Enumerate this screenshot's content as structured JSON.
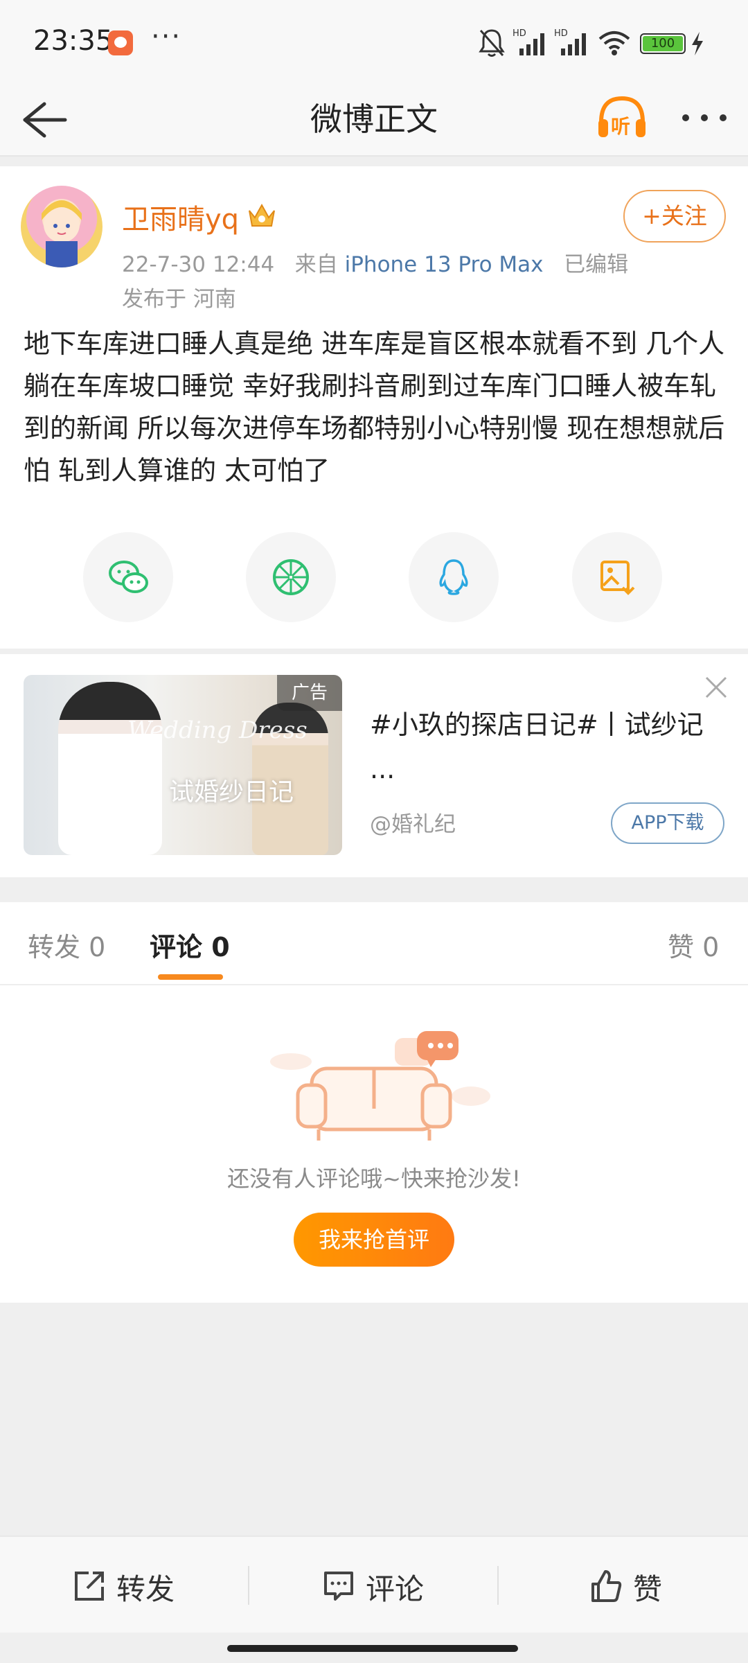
{
  "status_bar": {
    "time": "23:35",
    "more_dots": "···",
    "battery": "100",
    "icons": [
      "silent-bell-icon",
      "hd-signal-icon",
      "hd-signal-icon",
      "wifi-icon",
      "battery-icon",
      "charging-icon"
    ]
  },
  "header": {
    "title": "微博正文",
    "icons": [
      "back-arrow-icon",
      "listen-headphones-icon",
      "more-dots-icon"
    ],
    "listen_label": "听"
  },
  "post": {
    "username": "卫雨晴yq",
    "date": "22-7-30 12:44",
    "source_prefix": "来自",
    "device": "iPhone 13 Pro Max",
    "edited": "已编辑",
    "location": "发布于 河南",
    "follow_label": "+关注",
    "text": "地下车库进口睡人真是绝 进车库是盲区根本就看不到 几个人躺在车库坡口睡觉 幸好我刷抖音刷到过车库门口睡人被车轧到的新闻 所以每次进停车场都特别小心特别慢 现在想想就后怕 轧到人算谁的 太可怕了",
    "share_icons": [
      "wechat-icon",
      "moments-icon",
      "qq-icon",
      "save-image-icon"
    ]
  },
  "ad": {
    "badge": "广告",
    "image_script": "Wedding Dress",
    "image_caption": "试婚纱日记",
    "title": "#小玖的探店日记#丨试纱记 ...",
    "source": "@婚礼纪",
    "download_label": "APP下载"
  },
  "comments": {
    "tabs": [
      {
        "label": "转发 0"
      },
      {
        "label": "评论 0"
      },
      {
        "label": "赞 0"
      }
    ],
    "active_tab": "评论 0",
    "empty_text": "还没有人评论哦~快来抢沙发!",
    "first_comment_label": "我来抢首评"
  },
  "bottom_bar": {
    "repost_label": "转发",
    "comment_label": "评论",
    "like_label": "赞"
  },
  "colors": {
    "accent_orange": "#e8711a",
    "link_blue": "#4c78a8",
    "button_orange": "#ff8a0d"
  }
}
